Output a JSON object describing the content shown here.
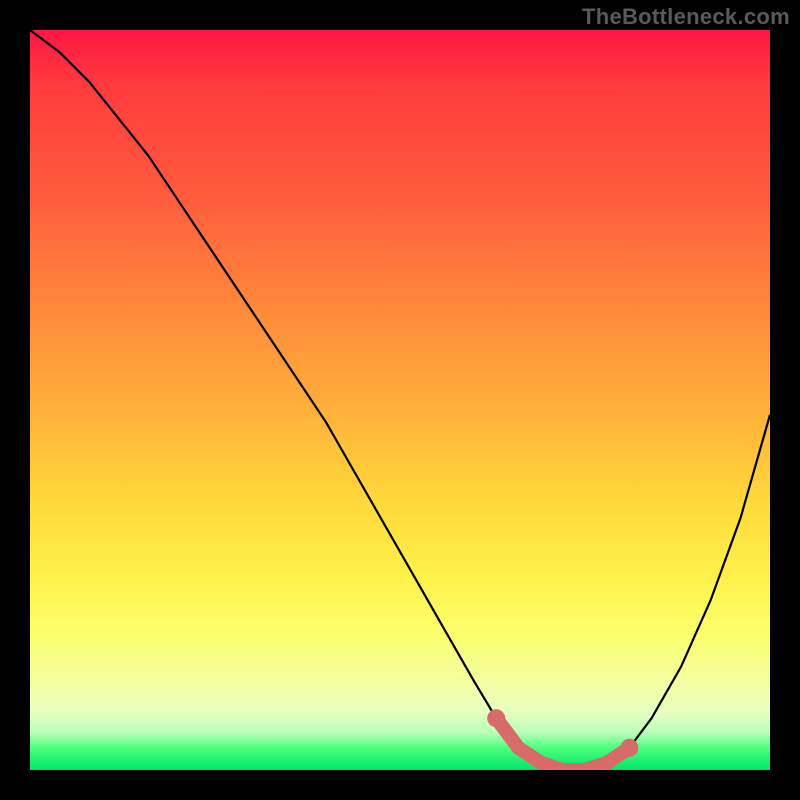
{
  "watermark": "TheBottleneck.com",
  "chart_data": {
    "type": "line",
    "title": "",
    "xlabel": "",
    "ylabel": "",
    "xlim": [
      0,
      100
    ],
    "ylim": [
      0,
      100
    ],
    "grid": false,
    "legend": false,
    "series": [
      {
        "name": "bottleneck-curve",
        "x": [
          0,
          4,
          8,
          12,
          16,
          20,
          24,
          28,
          32,
          36,
          40,
          44,
          48,
          52,
          56,
          60,
          63,
          66,
          69,
          72,
          75,
          78,
          81,
          84,
          88,
          92,
          96,
          100
        ],
        "values": [
          100,
          97,
          93,
          88,
          83,
          77,
          71,
          65,
          59,
          53,
          47,
          40,
          33,
          26,
          19,
          12,
          7,
          3,
          1,
          0,
          0,
          1,
          3,
          7,
          14,
          23,
          34,
          48
        ]
      }
    ],
    "highlight_range_x": [
      63,
      81
    ],
    "annotations": []
  }
}
